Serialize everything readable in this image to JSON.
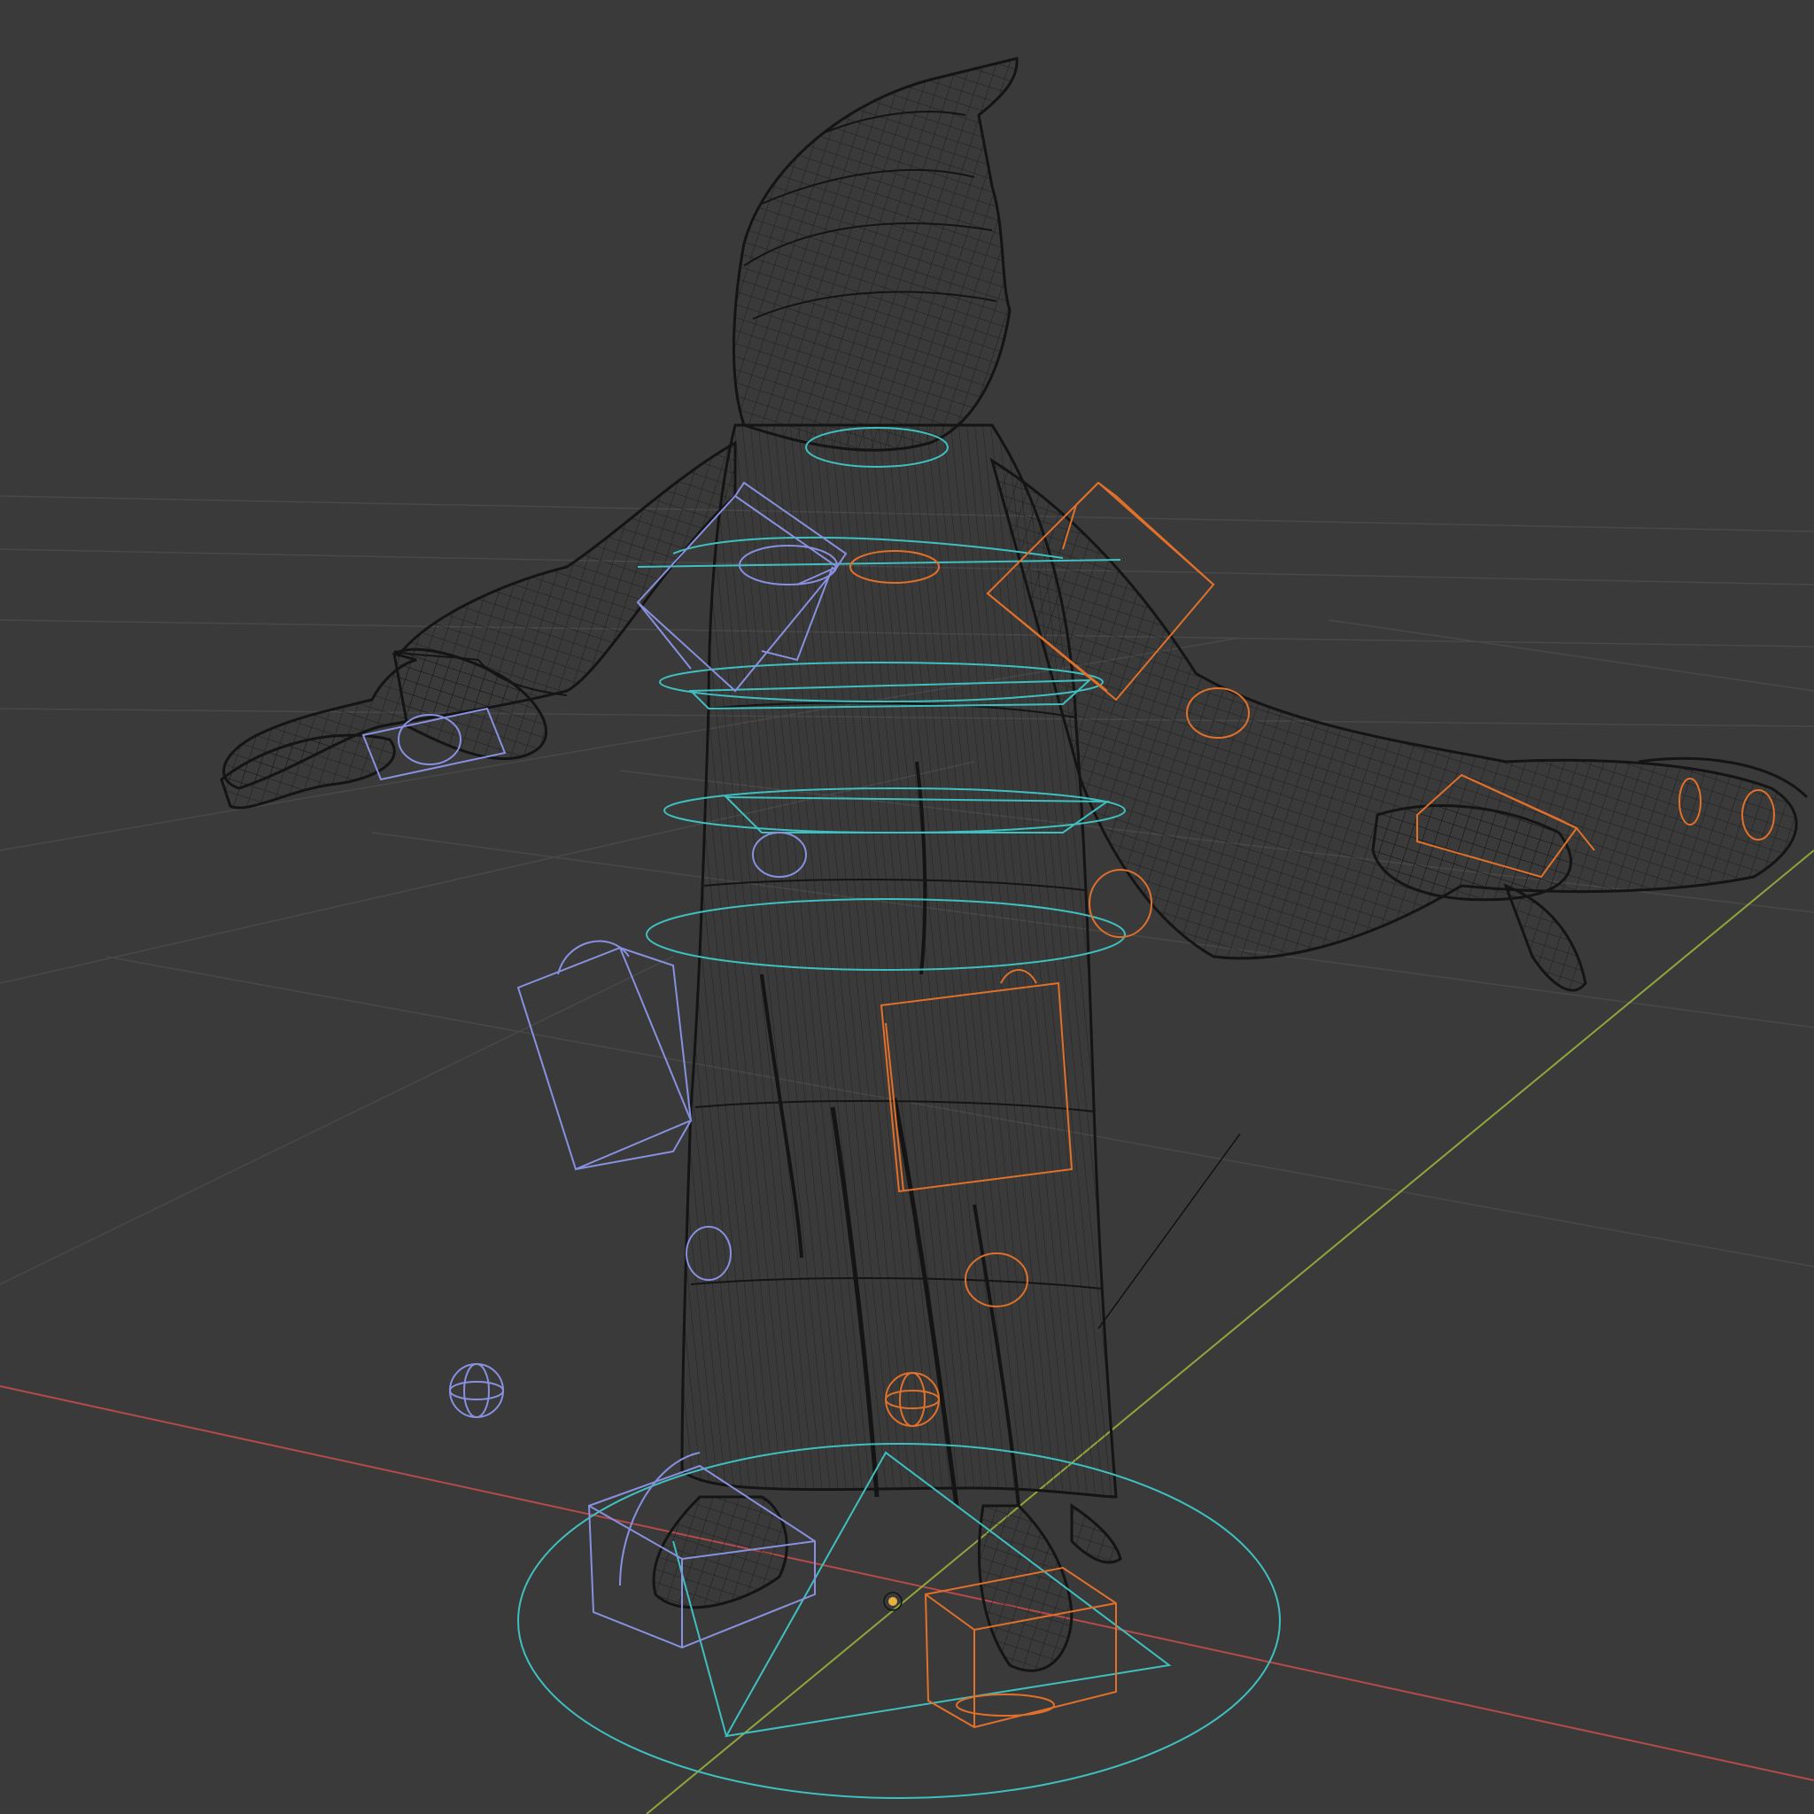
{
  "viewport": {
    "mode": "wireframe",
    "background": "#3a3a3a",
    "grid_color": "#4a4a4a",
    "mesh_color": "#141414",
    "x_axis_color": "#b44a4a",
    "y_axis_color": "#8fa63a",
    "bone_left_color": "#8890e0",
    "bone_right_color": "#e0702a",
    "control_color": "#3fc0c0",
    "origin_color": "#e8b040"
  }
}
